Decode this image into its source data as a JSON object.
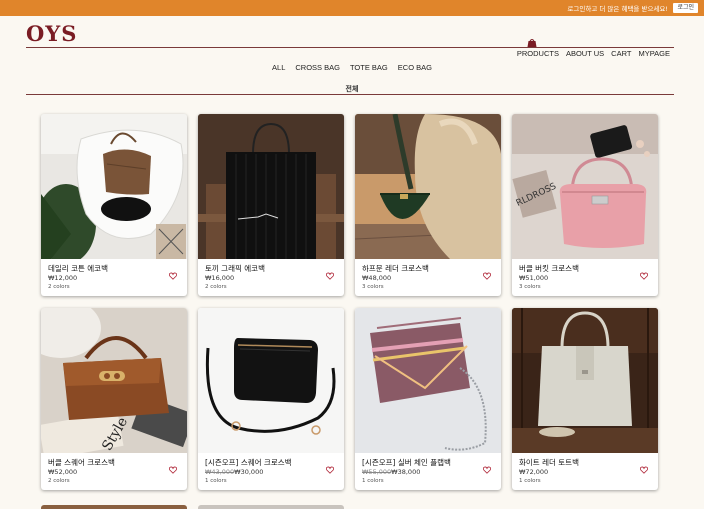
{
  "topbar": {
    "message": "로그인하고 더 많은 혜택을 받으세요!",
    "login_label": "로그인",
    "color": "#e0852b"
  },
  "brand": {
    "logo": "OYS",
    "color": "#7a1c24"
  },
  "main_nav": [
    {
      "label": "PRODUCTS"
    },
    {
      "label": "ABOUT US"
    },
    {
      "label": "CART"
    },
    {
      "label": "MYPAGE"
    }
  ],
  "category_nav": [
    {
      "label": "ALL"
    },
    {
      "label": "CROSS BAG"
    },
    {
      "label": "TOTE BAG"
    },
    {
      "label": "ECO BAG"
    }
  ],
  "section": {
    "title": "전체"
  },
  "products": [
    {
      "name": "데일리 코튼 에코백",
      "price": "₩12,000",
      "original_price": "",
      "colors": "2 colors",
      "image": "cotton-bag-on-chair"
    },
    {
      "name": "토끼 그래픽 에코백",
      "price": "₩16,000",
      "original_price": "",
      "colors": "2 colors",
      "image": "black-tote-on-chair"
    },
    {
      "name": "하프문 레더 크로스백",
      "price": "₩48,000",
      "original_price": "",
      "colors": "3 colors",
      "image": "green-halfmoon-bag"
    },
    {
      "name": "버클 버킷 크로스백",
      "price": "₩51,000",
      "original_price": "",
      "colors": "3 colors",
      "image": "pink-bucket-bag"
    },
    {
      "name": "버클 스퀘어 크로스백",
      "price": "₩52,000",
      "original_price": "",
      "colors": "2 colors",
      "image": "brown-buckle-bag"
    },
    {
      "name": "[시즌오프] 스퀘어 크로스백",
      "price": "₩30,000",
      "original_price": "₩43,000",
      "colors": "1 colors",
      "image": "black-square-bag"
    },
    {
      "name": "[시즌오프] 실버 체인 플랩백",
      "price": "₩38,000",
      "original_price": "₩55,000",
      "colors": "1 colors",
      "image": "mauve-chain-bag"
    },
    {
      "name": "화이트 레더 토트백",
      "price": "₩72,000",
      "original_price": "",
      "colors": "1 colors",
      "image": "white-leather-tote"
    }
  ]
}
